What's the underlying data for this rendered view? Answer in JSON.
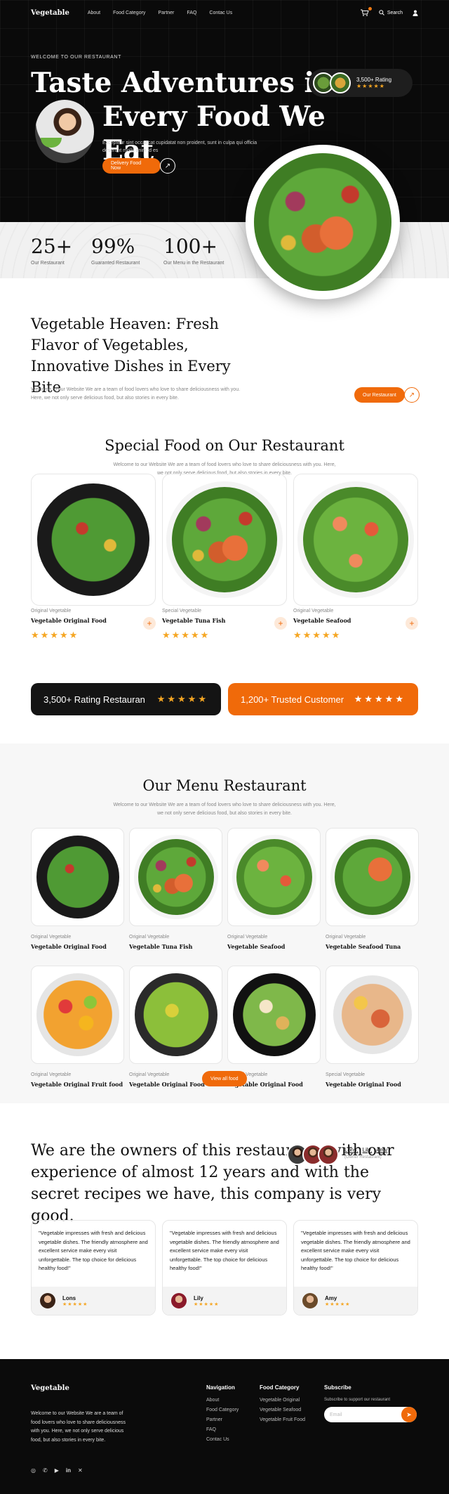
{
  "nav": {
    "logo": "Vegetable",
    "links": [
      "About",
      "Food Category",
      "Partner",
      "FAQ",
      "Contac Us"
    ],
    "search": "Search"
  },
  "hero": {
    "welcome": "WELCOME TO OUR RESTAURANT",
    "title_l1": "Taste Adventures in",
    "title_l2": "Every Food We Eat",
    "rating": "3,500+ Rating",
    "description": "Excepteur sint occaecat cupidatat non proident, sunt in culpa qui officia deserunt mollit anim id es",
    "cta": "Delivery Food Now"
  },
  "stats": [
    {
      "num": "25+",
      "label": "Our Restaurant"
    },
    {
      "num": "99%",
      "label": "Guaranted Restaurant"
    },
    {
      "num": "100+",
      "label": "Our Menu in the Restaurant"
    }
  ],
  "heaven": {
    "title": "Vegetable Heaven: Fresh Flavor of Vegetables, Innovative Dishes in Every Bite",
    "text": "Welcome to our Website We are a team of food lovers who love to share deliciousness with you. Here, we not only serve delicious food, but also stories in every bite.",
    "button": "Our Restaurant"
  },
  "special": {
    "title": "Special Food on Our Restaurant",
    "subtitle": "Welcome to our Website We are a team of food lovers who love to share deliciousness with you. Here, we not only serve delicious food, but also stories in every bite.",
    "items": [
      {
        "cat": "Original Vegetable",
        "name": "Vegetable Original Food"
      },
      {
        "cat": "Special Vegetable",
        "name": "Vegetable Tuna Fish"
      },
      {
        "cat": "Original Vegetable",
        "name": "Vegetable Seafood"
      }
    ],
    "stars": "★★★★★"
  },
  "banners": {
    "left": "3,500+ Rating Restauran",
    "right": "1,200+ Trusted Customer",
    "stars": "★★★★★"
  },
  "menu": {
    "title": "Our Menu Restaurant",
    "subtitle": "Welcome to our Website We are a team of food lovers who love to share deliciousness with you. Here, we not only serve delicious food, but also stories in every bite.",
    "items": [
      {
        "cat": "Original Vegetable",
        "name": "Vegetable Original Food"
      },
      {
        "cat": "Original Vegetable",
        "name": "Vegetable Tuna Fish"
      },
      {
        "cat": "Original Vegetable",
        "name": "Vegetable Seafood"
      },
      {
        "cat": "Original Vegetable",
        "name": "Vegetable Seafood  Tuna"
      },
      {
        "cat": "Original Vegetable",
        "name": "Vegetable Original Fruit food"
      },
      {
        "cat": "Original Vegetable",
        "name": "Vegetable Original Food"
      },
      {
        "cat": "Original Vegetable",
        "name": "Vegetable Original Food"
      },
      {
        "cat": "Special Vegetable",
        "name": "Vegetable Original Food"
      }
    ],
    "button": "View all food"
  },
  "owners": {
    "title": "We are the owners of this restaurant, with our experience of almost 12 years and with the secret recipes we have, this company is very good.",
    "names": [
      "Lons,",
      "Lily,",
      "Amy"
    ],
    "role": "(Owner Restaurant)"
  },
  "testimonials": [
    {
      "quote": "\"Vegetable impresses with fresh and delicious vegetable dishes. The friendly atmosphere and excellent service make every visit unforgettable. The top choice for delicious healthy food!\"",
      "name": "Lons",
      "stars": "★★★★★"
    },
    {
      "quote": "\"Vegetable impresses with fresh and delicious vegetable dishes. The friendly atmosphere and excellent service make every visit unforgettable. The top choice for delicious healthy food!\"",
      "name": "Lily",
      "stars": "★★★★★"
    },
    {
      "quote": "\"Vegetable impresses with fresh and delicious vegetable dishes. The friendly atmosphere and excellent service make every visit unforgettable. The top choice for delicious healthy food!\"",
      "name": "Amy",
      "stars": "★★★★★"
    }
  ],
  "footer": {
    "logo": "Vegetable",
    "desc": "Welcome to our Website We are a team of food lovers who love to share deliciousness with you. Here, we not only serve delicious food, but also stories in every bite.",
    "nav_title": "Navigation",
    "nav": [
      "About",
      "Food Category",
      "Partner",
      "FAQ",
      "Contac Us"
    ],
    "cat_title": "Food Category",
    "cats": [
      "Vegetable Original",
      "Vegetable Seafood",
      "Vegetable Fruit Food"
    ],
    "sub_title": "Subscribe",
    "sub_note": "Subscribe to support our restaurant",
    "email_placeholder": "Email"
  },
  "colors": {
    "accent": "#f06a0a",
    "dark": "#0a0a0a",
    "star": "#f5a623"
  }
}
